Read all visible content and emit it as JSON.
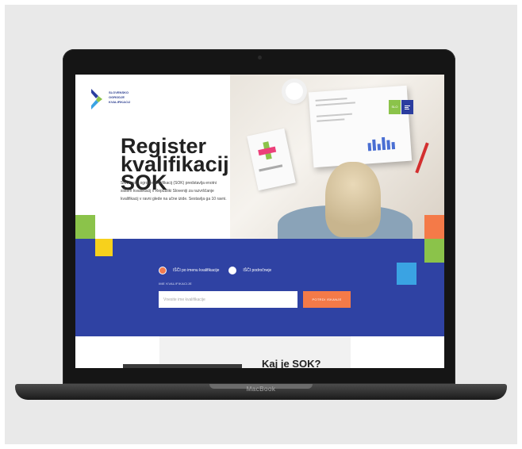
{
  "page": {
    "brand_label": "MacBook"
  },
  "site": {
    "logo_text": "SLOVENSKO OGRODJE KVALIFIKACIJ",
    "hero_title": "Register kvalifikacij SOK",
    "hero_sub": "Slovensko ogrodje kvalifikacij (SOK) predstavlja enotni sistem kvalifikacij v Republiki Sloveniji za razvrščanje kvalifikacij v ravni glede na učne izide. Sestavlja ga 10 ravni.",
    "lang_label": "SLO",
    "search": {
      "radio_1": "IŠČI po imenu kvalifikacije",
      "radio_2": "IŠČI področneje",
      "field_label": "IME KVALIFIKACIJE",
      "placeholder": "Vnesite ime kvalifikacije",
      "button": "POTRDI ISKANJE"
    },
    "next_title": "Kaj je SOK?"
  },
  "colors": {
    "blue": "#2f42a3",
    "orange": "#f47a48",
    "green": "#8bc34a",
    "yellow": "#f7d11c",
    "light_blue": "#3aa3e3"
  }
}
